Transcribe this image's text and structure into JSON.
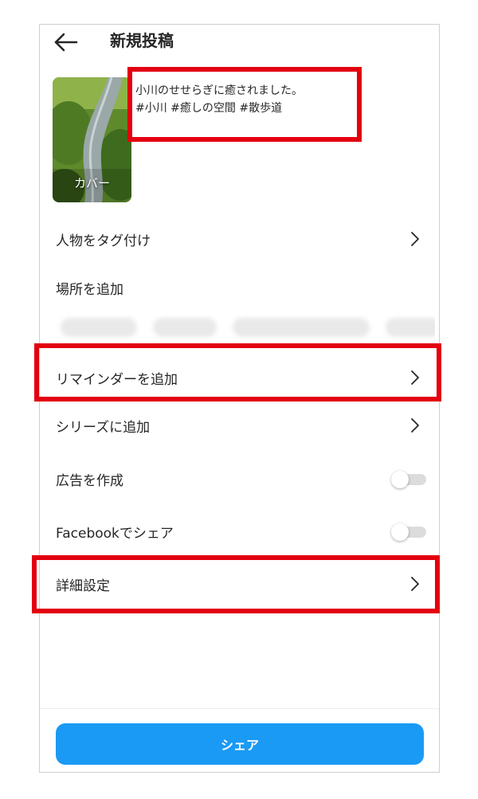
{
  "header": {
    "title": "新規投稿"
  },
  "cover": {
    "label": "カバー"
  },
  "caption": {
    "line1": "小川のせせらぎに癒されました。",
    "line2": "#小川 #癒しの空間 #散歩道"
  },
  "menu": {
    "tag_people": "人物をタグ付け",
    "add_location": "場所を追加",
    "add_reminder": "リマインダーを追加",
    "add_series": "シリーズに追加",
    "create_ad": "広告を作成",
    "share_facebook": "Facebookでシェア",
    "advanced_settings": "詳細設定"
  },
  "toggles": {
    "create_ad_on": false,
    "share_facebook_on": false
  },
  "share_button": {
    "label": "シェア"
  },
  "colors": {
    "accent": "#1a9af5",
    "highlight": "#e3000f"
  }
}
